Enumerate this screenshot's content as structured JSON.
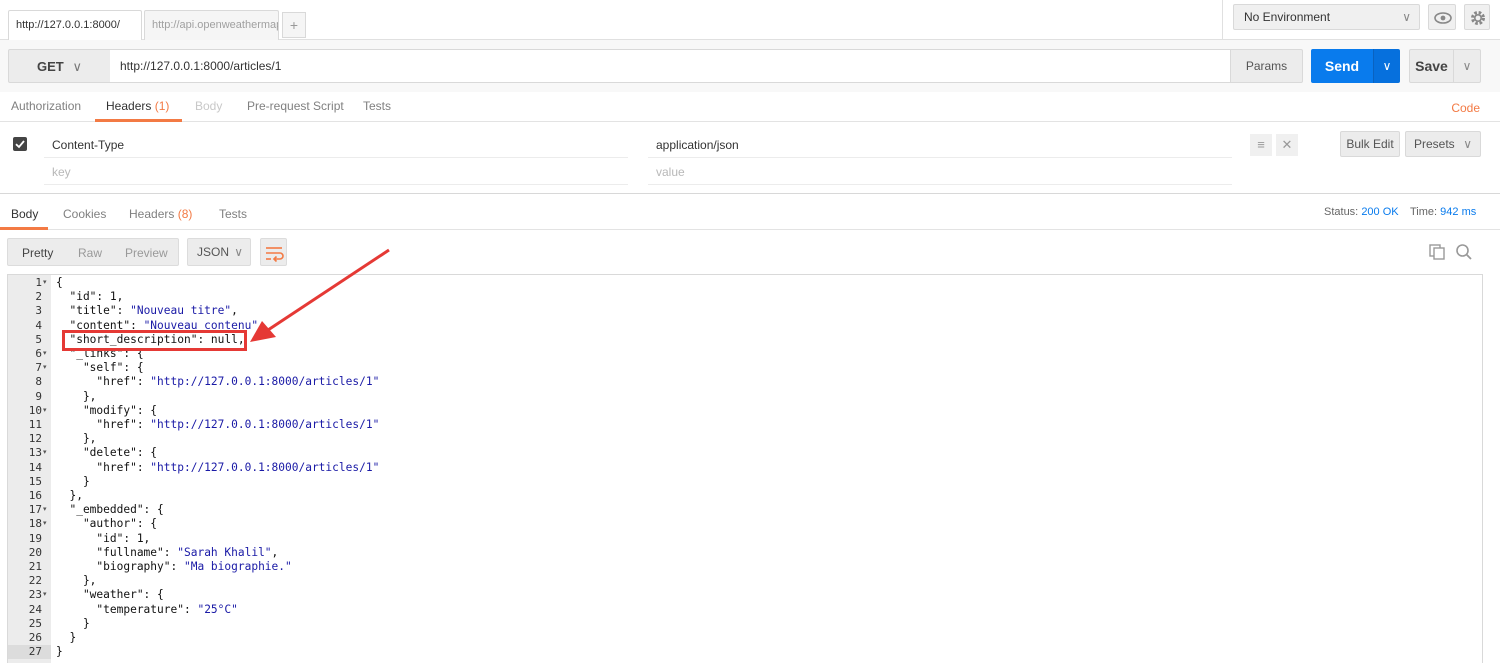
{
  "tabs": {
    "active_label": "http://127.0.0.1:8000/",
    "inactive_label": "http://api.openweathermap",
    "add_label": "+"
  },
  "environment": {
    "selected": "No Environment",
    "chevron": "∨"
  },
  "request": {
    "method": "GET",
    "url": "http://127.0.0.1:8000/articles/1",
    "params_label": "Params",
    "send_label": "Send",
    "save_label": "Save"
  },
  "request_tabs": {
    "authorization": "Authorization",
    "headers": "Headers",
    "headers_count": "(1)",
    "body": "Body",
    "prerequest": "Pre-request Script",
    "tests": "Tests",
    "code": "Code"
  },
  "headers_table": {
    "key": "Content-Type",
    "value": "application/json",
    "key_placeholder": "key",
    "value_placeholder": "value",
    "bulk_edit_label": "Bulk Edit",
    "presets_label": "Presets"
  },
  "response_tabs": {
    "body": "Body",
    "cookies": "Cookies",
    "headers": "Headers",
    "headers_count": "(8)",
    "tests": "Tests",
    "status_label": "Status:",
    "status_value": "200 OK",
    "time_label": "Time:",
    "time_value": "942 ms"
  },
  "view": {
    "pretty": "Pretty",
    "raw": "Raw",
    "preview": "Preview",
    "format": "JSON"
  },
  "code_lines": [
    {
      "n": "1",
      "fold": true,
      "text": "{"
    },
    {
      "n": "2",
      "fold": false,
      "text": "  \"id\": 1,"
    },
    {
      "n": "3",
      "fold": false,
      "text": "  \"title\": \"Nouveau titre\","
    },
    {
      "n": "4",
      "fold": false,
      "text": "  \"content\": \"Nouveau contenu\","
    },
    {
      "n": "5",
      "fold": false,
      "text": "  \"short_description\": null,"
    },
    {
      "n": "6",
      "fold": true,
      "text": "  \"_links\": {"
    },
    {
      "n": "7",
      "fold": true,
      "text": "    \"self\": {"
    },
    {
      "n": "8",
      "fold": false,
      "text": "      \"href\": \"http://127.0.0.1:8000/articles/1\""
    },
    {
      "n": "9",
      "fold": false,
      "text": "    },"
    },
    {
      "n": "10",
      "fold": true,
      "text": "    \"modify\": {"
    },
    {
      "n": "11",
      "fold": false,
      "text": "      \"href\": \"http://127.0.0.1:8000/articles/1\""
    },
    {
      "n": "12",
      "fold": false,
      "text": "    },"
    },
    {
      "n": "13",
      "fold": true,
      "text": "    \"delete\": {"
    },
    {
      "n": "14",
      "fold": false,
      "text": "      \"href\": \"http://127.0.0.1:8000/articles/1\""
    },
    {
      "n": "15",
      "fold": false,
      "text": "    }"
    },
    {
      "n": "16",
      "fold": false,
      "text": "  },"
    },
    {
      "n": "17",
      "fold": true,
      "text": "  \"_embedded\": {"
    },
    {
      "n": "18",
      "fold": true,
      "text": "    \"author\": {"
    },
    {
      "n": "19",
      "fold": false,
      "text": "      \"id\": 1,"
    },
    {
      "n": "20",
      "fold": false,
      "text": "      \"fullname\": \"Sarah Khalil\","
    },
    {
      "n": "21",
      "fold": false,
      "text": "      \"biography\": \"Ma biographie.\""
    },
    {
      "n": "22",
      "fold": false,
      "text": "    },"
    },
    {
      "n": "23",
      "fold": true,
      "text": "    \"weather\": {"
    },
    {
      "n": "24",
      "fold": false,
      "text": "      \"temperature\": \"25°C\""
    },
    {
      "n": "25",
      "fold": false,
      "text": "    }"
    },
    {
      "n": "26",
      "fold": false,
      "text": "  }"
    },
    {
      "n": "27",
      "fold": false,
      "text": "}"
    }
  ],
  "icons": {
    "eye": "eye-icon",
    "gear": "gear-icon",
    "checkbox": "checkmark-icon",
    "drag": "drag-handle-icon",
    "delete": "close-icon",
    "wrap": "wrap-lines-icon",
    "copy": "copy-icon",
    "search": "search-icon",
    "chevron": "∨",
    "fold": "▾"
  },
  "colors": {
    "accent": "#f37a44",
    "send": "#097bed",
    "annotation": "#e53935",
    "string": "#1a1aa6"
  }
}
